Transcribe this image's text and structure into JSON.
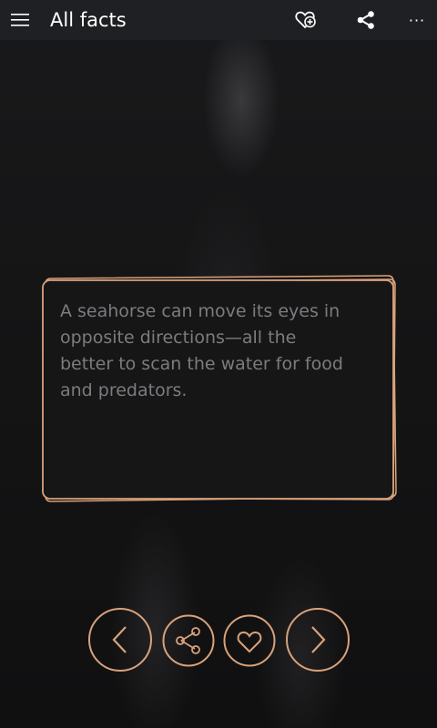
{
  "appbar": {
    "title": "All facts",
    "menu_icon": "hamburger-icon",
    "favorite_add_icon": "heart-plus-icon",
    "share_icon": "share-icon",
    "more_icon": "more-icon",
    "more_label": "···"
  },
  "fact": {
    "text": "A seahorse can move its eyes in opposite directions—all the better to scan the water for food and predators."
  },
  "controls": {
    "previous_icon": "chevron-left-icon",
    "share_icon": "share-icon",
    "favorite_icon": "heart-icon",
    "next_icon": "chevron-right-icon"
  },
  "colors": {
    "accent": "#d9a27a",
    "appbar": "#1f2023",
    "background": "#151516",
    "fact_text": "#7c7c80"
  }
}
